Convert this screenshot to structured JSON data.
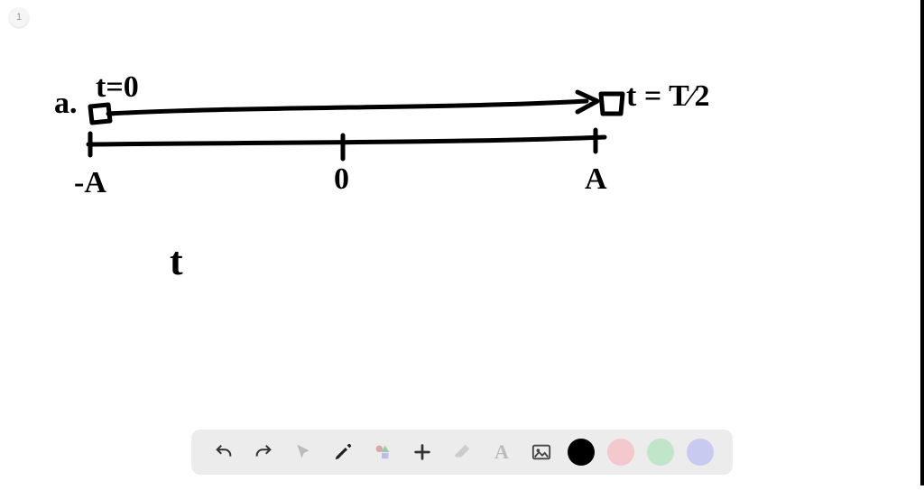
{
  "page_badge": "1",
  "diagram": {
    "part_label": "a.",
    "left_time_label": "t=0",
    "right_time_label": "t = T⁄2",
    "axis": {
      "left_label": "-A",
      "center_label": "0",
      "right_label": "A"
    },
    "floating_label": "t"
  },
  "toolbar": {
    "undo": "undo",
    "redo": "redo",
    "pointer": "pointer",
    "pen": "pen",
    "shapes": "shapes",
    "move": "move",
    "eraser": "eraser",
    "text": "text",
    "image": "image",
    "colors": {
      "black": "#000000",
      "pink": "#f3c9ce",
      "green": "#c0e5c8",
      "purple": "#c8caef"
    }
  }
}
